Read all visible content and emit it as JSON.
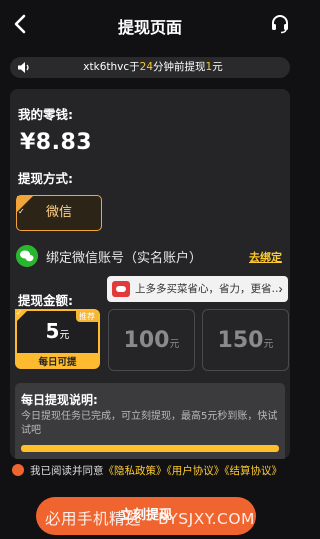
{
  "header": {
    "title": "提现页面"
  },
  "notice": {
    "user": "xtk6thvc",
    "pre": "于",
    "minutes": "24",
    "mid": "分钟前提现",
    "amount": "1",
    "unit": "元"
  },
  "wallet": {
    "label": "我的零钱:",
    "balance": "¥8.83"
  },
  "method": {
    "label": "提现方式:",
    "option": "微信",
    "check": "✓"
  },
  "wechat_bind": {
    "text": "绑定微信账号（实名账户）",
    "link": "去绑定"
  },
  "amount": {
    "label": "提现金额:",
    "options": [
      {
        "value": "5",
        "unit": "元",
        "caption": "每日可提",
        "badge": "推荐",
        "selected": true
      },
      {
        "value": "100",
        "unit": "元",
        "selected": false
      },
      {
        "value": "150",
        "unit": "元",
        "selected": false
      }
    ]
  },
  "ad": {
    "text": "上多多买菜省心，省力，更省…"
  },
  "daily_info": {
    "title": "每日提现说明:",
    "desc": "今日提现任务已完成，可立刻提现，最高5元秒到账，快试试吧",
    "progress": 1.0
  },
  "agreement": {
    "prefix": "我已阅读并同意",
    "policy1": "《隐私政策》",
    "policy2": "《用户协议》",
    "policy3": "《结算协议》"
  },
  "submit": {
    "label": "立刻提现"
  },
  "watermark": "必用手机精选 - BYSJXY.COM",
  "colors": {
    "accent": "#ffcb30",
    "button": "#f0652f",
    "wechat": "#29b62e",
    "background": "#111113"
  }
}
